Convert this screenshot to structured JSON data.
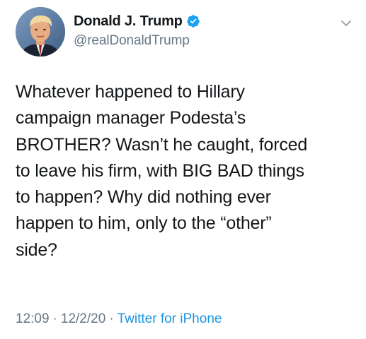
{
  "tweet": {
    "display_name": "Donald J. Trump",
    "handle": "@realDonaldTrump",
    "text": "Whatever happened to Hillary\ncampaign manager Podesta’s\nBROTHER? Wasn’t he caught, forced\nto leave his firm, with BIG BAD things\nto happen? Why did nothing ever\nhappen to him, only to the “other”\nside?",
    "time": "12:09",
    "date": "12/2/20",
    "separator": "·",
    "source": "Twitter for iPhone"
  },
  "icons": {
    "avatar": "profile-photo",
    "verified": "verified-badge-icon",
    "menu": "chevron-down-icon"
  },
  "colors": {
    "verified_blue": "#1da1f2",
    "link_blue": "#1b95e0",
    "secondary_text": "#657786",
    "primary_text": "#14171a"
  }
}
